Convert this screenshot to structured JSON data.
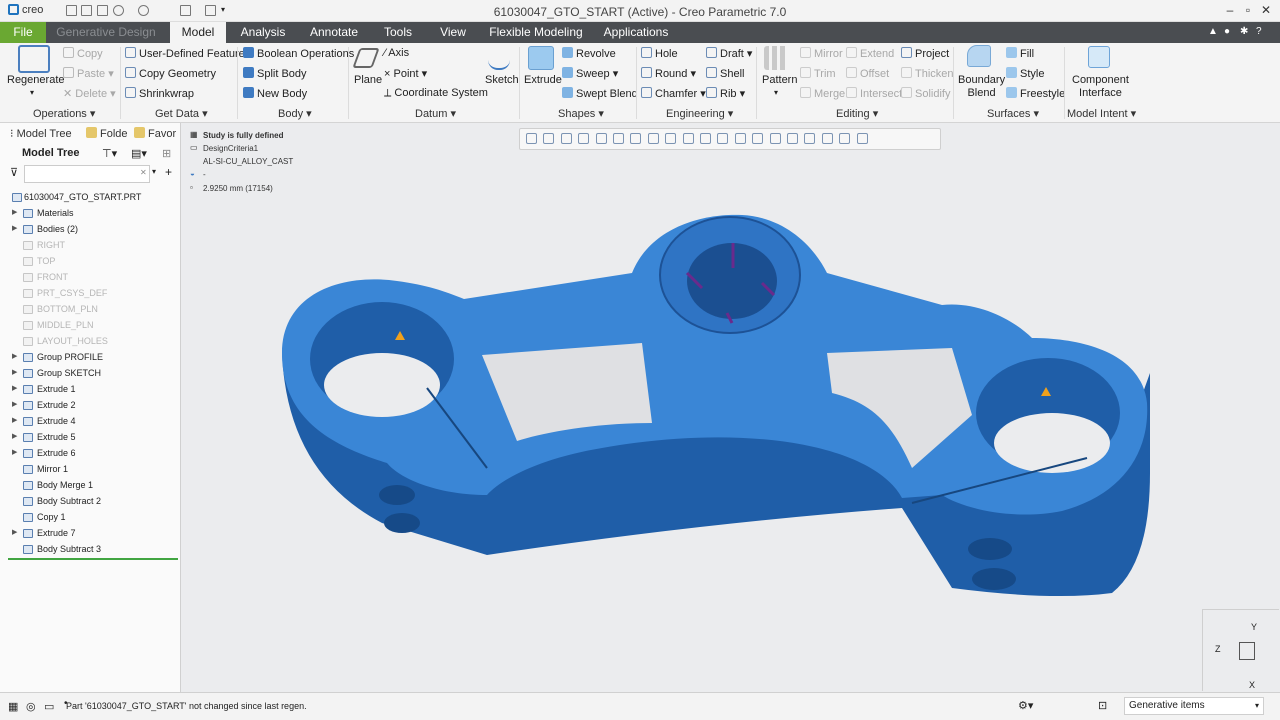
{
  "title": "61030047_GTO_START (Active) - Creo Parametric 7.0",
  "logo_text": "creo",
  "tabs": [
    "File",
    "Generative Design",
    "Model",
    "Analysis",
    "Annotate",
    "Tools",
    "View",
    "Flexible Modeling",
    "Applications"
  ],
  "ribbon": {
    "regenerate": "Regenerate",
    "copy": "Copy",
    "paste": "Paste",
    "delete": "Delete",
    "user_defined_feature": "User-Defined Feature",
    "copy_geometry": "Copy Geometry",
    "shrinkwrap": "Shrinkwrap",
    "boolean_operations": "Boolean Operations",
    "split_body": "Split Body",
    "new_body": "New Body",
    "plane": "Plane",
    "axis": "Axis",
    "point": "Point",
    "coordinate_system": "Coordinate System",
    "sketch": "Sketch",
    "extrude": "Extrude",
    "revolve": "Revolve",
    "sweep": "Sweep",
    "swept_blend": "Swept Blend",
    "hole": "Hole",
    "round": "Round",
    "chamfer": "Chamfer",
    "draft": "Draft",
    "shell": "Shell",
    "rib": "Rib",
    "pattern": "Pattern",
    "mirror": "Mirror",
    "trim": "Trim",
    "merge": "Merge",
    "extend": "Extend",
    "offset": "Offset",
    "intersect": "Intersect",
    "project": "Project",
    "thicken": "Thicken",
    "solidify": "Solidify",
    "boundary_blend": "Boundary\nBlend",
    "fill": "Fill",
    "style": "Style",
    "freestyle": "Freestyle",
    "component_interface": "Component\nInterface",
    "groups": [
      "Operations",
      "Get Data",
      "Body",
      "Datum",
      "Shapes",
      "Engineering",
      "Editing",
      "Surfaces",
      "Model Intent"
    ]
  },
  "left_tabs": [
    "Model Tree",
    "Folde",
    "Favor"
  ],
  "model_tree_label": "Model Tree",
  "tree": [
    {
      "label": "61030047_GTO_START.PRT",
      "exp": false,
      "dim": false
    },
    {
      "label": "Materials",
      "exp": true,
      "dim": false
    },
    {
      "label": "Bodies (2)",
      "exp": true,
      "dim": false
    },
    {
      "label": "RIGHT",
      "exp": false,
      "dim": true
    },
    {
      "label": "TOP",
      "exp": false,
      "dim": true
    },
    {
      "label": "FRONT",
      "exp": false,
      "dim": true
    },
    {
      "label": "PRT_CSYS_DEF",
      "exp": false,
      "dim": true
    },
    {
      "label": "BOTTOM_PLN",
      "exp": false,
      "dim": true
    },
    {
      "label": "MIDDLE_PLN",
      "exp": false,
      "dim": true
    },
    {
      "label": "LAYOUT_HOLES",
      "exp": false,
      "dim": true
    },
    {
      "label": "Group PROFILE",
      "exp": true,
      "dim": false
    },
    {
      "label": "Group SKETCH",
      "exp": true,
      "dim": false
    },
    {
      "label": "Extrude 1",
      "exp": true,
      "dim": false
    },
    {
      "label": "Extrude 2",
      "exp": true,
      "dim": false
    },
    {
      "label": "Extrude 4",
      "exp": true,
      "dim": false
    },
    {
      "label": "Extrude 5",
      "exp": true,
      "dim": false
    },
    {
      "label": "Extrude 6",
      "exp": true,
      "dim": false
    },
    {
      "label": "Mirror 1",
      "exp": false,
      "dim": false
    },
    {
      "label": "Body Merge 1",
      "exp": false,
      "dim": false
    },
    {
      "label": "Body Subtract 2",
      "exp": false,
      "dim": false
    },
    {
      "label": "Copy 1",
      "exp": false,
      "dim": false
    },
    {
      "label": "Extrude 7",
      "exp": true,
      "dim": false
    },
    {
      "label": "Body Subtract 3",
      "exp": false,
      "dim": false
    }
  ],
  "info": {
    "study": "Study is fully defined",
    "criteria": "DesignCriteria1",
    "material": "AL-SI-CU_ALLOY_CAST",
    "dash": "-",
    "mesh": "2.9250 mm (17154)"
  },
  "status_message": "Part '61030047_GTO_START' not changed since last regen.",
  "filter": "Generative items",
  "triad": {
    "y": "Y",
    "z": "Z",
    "x": "X"
  },
  "colors": {
    "model": "#2e78c4",
    "file_tab": "#6aa832",
    "tabbar": "#4a4d51"
  }
}
